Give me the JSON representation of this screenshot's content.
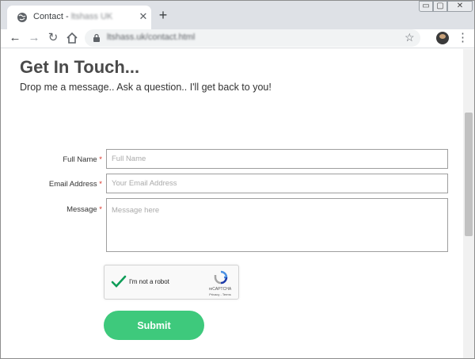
{
  "tab": {
    "title": "Contact - ",
    "title_site": "ltshass UK",
    "close": "✕",
    "new_tab": "+"
  },
  "window": {
    "min": "▭",
    "max": "▢",
    "close": "✕"
  },
  "toolbar": {
    "url": "ltshass.uk/contact.html"
  },
  "page": {
    "heading": "Get In Touch...",
    "subheading": "Drop me a message.. Ask a question.. I'll get back to you!"
  },
  "form": {
    "full_name": {
      "label": "Full Name",
      "required": "*",
      "placeholder": "Full Name",
      "value": ""
    },
    "email": {
      "label": "Email Address",
      "required": "*",
      "placeholder": "Your Email Address",
      "value": ""
    },
    "message": {
      "label": "Message",
      "required": "*",
      "placeholder": "Message here",
      "value": ""
    },
    "recaptcha": {
      "text": "I'm not a robot",
      "brand": "reCAPTCHA",
      "terms": "Privacy - Terms",
      "checked": true
    },
    "submit_label": "Submit"
  },
  "colors": {
    "accent": "#3ec97c",
    "check": "#0f9d58",
    "required": "#d93025"
  },
  "icons": {
    "tab_favicon": "globe-icon",
    "back": "arrow-left-icon",
    "forward": "arrow-right-icon",
    "reload": "reload-icon",
    "home": "home-icon",
    "lock": "lock-icon",
    "bookmark": "star-icon",
    "menu": "kebab-menu-icon"
  }
}
